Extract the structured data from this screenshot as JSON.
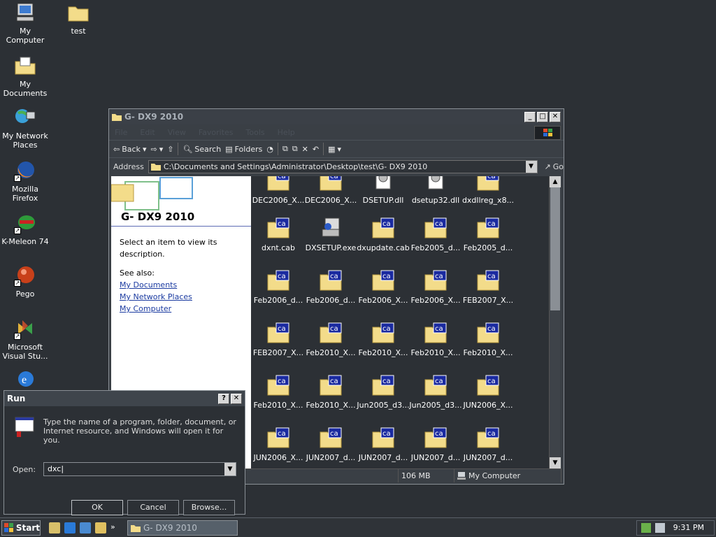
{
  "desktop": {
    "icons": [
      {
        "label": "My Computer",
        "icon": "computer-icon"
      },
      {
        "label": "test",
        "icon": "folder-icon"
      },
      {
        "label": "My Documents",
        "icon": "documents-folder-icon"
      },
      {
        "label": "My Network Places",
        "icon": "network-places-icon"
      },
      {
        "label": "Mozilla Firefox",
        "icon": "firefox-icon"
      },
      {
        "label": "K-Meleon 74",
        "icon": "kmeleon-icon"
      },
      {
        "label": "Pego",
        "icon": "pego-icon"
      },
      {
        "label": "Microsoft Visual Stu...",
        "icon": "visual-studio-icon"
      },
      {
        "label": "",
        "icon": "internet-explorer-icon"
      }
    ]
  },
  "explorer": {
    "title": "G- DX9 2010",
    "menu": [
      "File",
      "Edit",
      "View",
      "Favorites",
      "Tools",
      "Help"
    ],
    "toolbar": {
      "back": "Back",
      "search": "Search",
      "folders": "Folders"
    },
    "address_label": "Address",
    "address": "C:\\Documents and Settings\\Administrator\\Desktop\\test\\G- DX9 2010",
    "go": "Go",
    "task_pane": {
      "title": "G- DX9 2010",
      "description": "Select an item to view its description.",
      "see_also": "See also:",
      "links": [
        "My Documents",
        "My Network Places",
        "My Computer"
      ]
    },
    "files": [
      {
        "name": "DEC2006_X...",
        "type": "cab"
      },
      {
        "name": "DEC2006_X...",
        "type": "cab"
      },
      {
        "name": "DSETUP.dll",
        "type": "dll"
      },
      {
        "name": "dsetup32.dll",
        "type": "dll"
      },
      {
        "name": "dxdllreg_x8...",
        "type": "cab"
      },
      {
        "name": "dxnt.cab",
        "type": "cab"
      },
      {
        "name": "DXSETUP.exe",
        "type": "exe"
      },
      {
        "name": "dxupdate.cab",
        "type": "cab"
      },
      {
        "name": "Feb2005_d...",
        "type": "cab"
      },
      {
        "name": "Feb2005_d...",
        "type": "cab"
      },
      {
        "name": "Feb2006_d...",
        "type": "cab"
      },
      {
        "name": "Feb2006_d...",
        "type": "cab"
      },
      {
        "name": "Feb2006_X...",
        "type": "cab"
      },
      {
        "name": "Feb2006_X...",
        "type": "cab"
      },
      {
        "name": "FEB2007_X...",
        "type": "cab"
      },
      {
        "name": "FEB2007_X...",
        "type": "cab"
      },
      {
        "name": "Feb2010_X...",
        "type": "cab"
      },
      {
        "name": "Feb2010_X...",
        "type": "cab"
      },
      {
        "name": "Feb2010_X...",
        "type": "cab"
      },
      {
        "name": "Feb2010_X...",
        "type": "cab"
      },
      {
        "name": "Feb2010_X...",
        "type": "cab"
      },
      {
        "name": "Feb2010_X...",
        "type": "cab"
      },
      {
        "name": "Jun2005_d3...",
        "type": "cab"
      },
      {
        "name": "Jun2005_d3...",
        "type": "cab"
      },
      {
        "name": "JUN2006_X...",
        "type": "cab"
      },
      {
        "name": "JUN2006_X...",
        "type": "cab"
      },
      {
        "name": "JUN2007_d...",
        "type": "cab"
      },
      {
        "name": "JUN2007_d...",
        "type": "cab"
      },
      {
        "name": "JUN2007_d...",
        "type": "cab"
      },
      {
        "name": "JUN2007_d...",
        "type": "cab"
      }
    ],
    "status": {
      "size": "106 MB",
      "location": "My Computer"
    }
  },
  "run_dialog": {
    "title": "Run",
    "description": "Type the name of a program, folder, document, or Internet resource, and Windows will open it for you.",
    "open_label": "Open:",
    "open_value": "dxc",
    "ok": "OK",
    "cancel": "Cancel",
    "browse": "Browse..."
  },
  "taskbar": {
    "start": "Start",
    "task": "G- DX9 2010",
    "clock": "9:31 PM",
    "chevron": "»"
  },
  "colors": {
    "desktop": "#2c3035",
    "cab_badge": "#1a2aa0",
    "link": "#1a3aa0"
  }
}
